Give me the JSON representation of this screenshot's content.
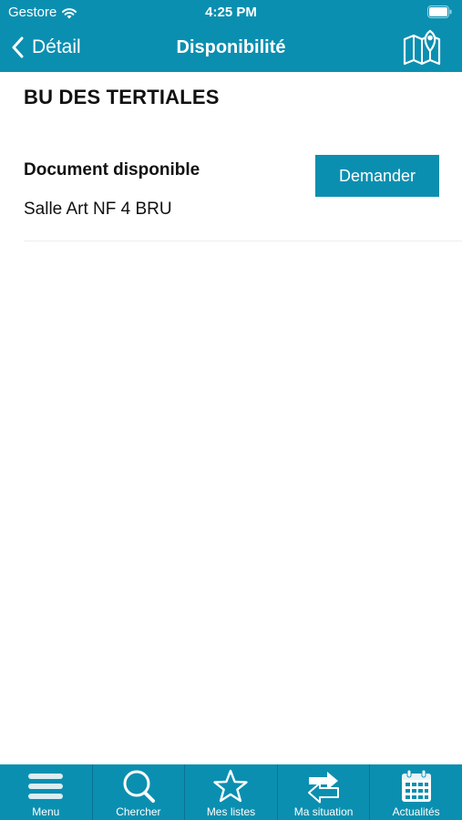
{
  "status_bar": {
    "carrier": "Gestore",
    "time": "4:25 PM"
  },
  "nav": {
    "back_label": "Détail",
    "title": "Disponibilité",
    "map_icon": "map-pin-icon"
  },
  "library": {
    "name": "BU DES TERTIALES"
  },
  "availability": {
    "status": "Document disponible",
    "location": "Salle Art NF 4 BRU",
    "request_label": "Demander"
  },
  "tabs": [
    {
      "label": "Menu",
      "icon": "menu-icon"
    },
    {
      "label": "Chercher",
      "icon": "search-icon"
    },
    {
      "label": "Mes listes",
      "icon": "star-icon"
    },
    {
      "label": "Ma situation",
      "icon": "swap-arrows-icon"
    },
    {
      "label": "Actualités",
      "icon": "calendar-icon"
    }
  ],
  "colors": {
    "primary": "#0b8fb0",
    "text": "#111111",
    "on_primary": "#ffffff"
  }
}
